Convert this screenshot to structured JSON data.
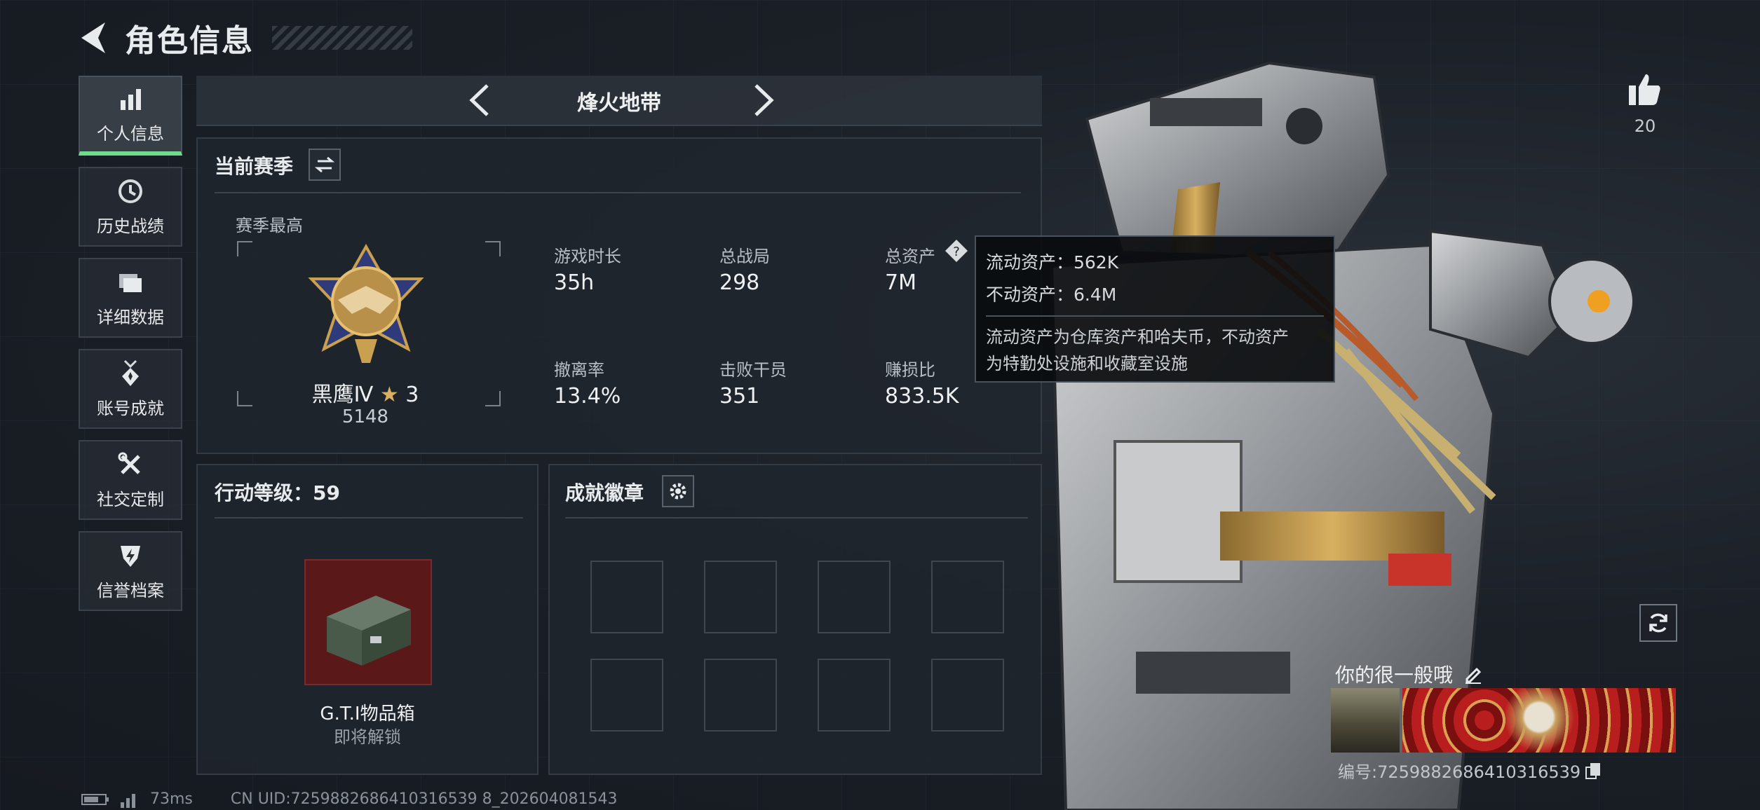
{
  "header": {
    "title": "角色信息"
  },
  "sidebar": {
    "items": [
      {
        "label": "个人信息",
        "icon": "bar-chart-icon",
        "active": true
      },
      {
        "label": "历史战绩",
        "icon": "clock-history-icon"
      },
      {
        "label": "详细数据",
        "icon": "folder-icon"
      },
      {
        "label": "账号成就",
        "icon": "medal-icon"
      },
      {
        "label": "社交定制",
        "icon": "tools-icon"
      },
      {
        "label": "信誉档案",
        "icon": "shield-icon"
      }
    ]
  },
  "season_nav": {
    "name": "烽火地带"
  },
  "season_panel": {
    "title": "当前赛季",
    "best_label": "赛季最高",
    "rank_name": "黑鹰Ⅳ",
    "rank_stars": "3",
    "rank_score": "5148",
    "stats": [
      {
        "label": "游戏时长",
        "value": "35h"
      },
      {
        "label": "总战局",
        "value": "298"
      },
      {
        "label": "总资产",
        "value": "7M"
      },
      {
        "label": "撤离率",
        "value": "13.4%"
      },
      {
        "label": "击败干员",
        "value": "351"
      },
      {
        "label": "赚损比",
        "value": "833.5K"
      }
    ]
  },
  "tooltip": {
    "line1": "流动资产：562K",
    "line2": "不动资产：6.4M",
    "desc1": "流动资产为仓库资产和哈夫币，不动资产",
    "desc2": "为特勤处设施和收藏室设施"
  },
  "action_panel": {
    "title": "行动等级：59",
    "item_name": "G.T.I物品箱",
    "item_status": "即将解锁"
  },
  "badge_panel": {
    "title": "成就徽章"
  },
  "likes": {
    "count": "20"
  },
  "card": {
    "name": "你的很一般哦",
    "id": "编号:7259882686410316539"
  },
  "footer": {
    "ping": "73ms",
    "uid": "CN UID:7259882686410316539 8_202604081543"
  },
  "colors": {
    "accent_green": "#6fdc8c",
    "panel_bg": "#20262d",
    "tooltip_bg": "#0a0c0e"
  }
}
